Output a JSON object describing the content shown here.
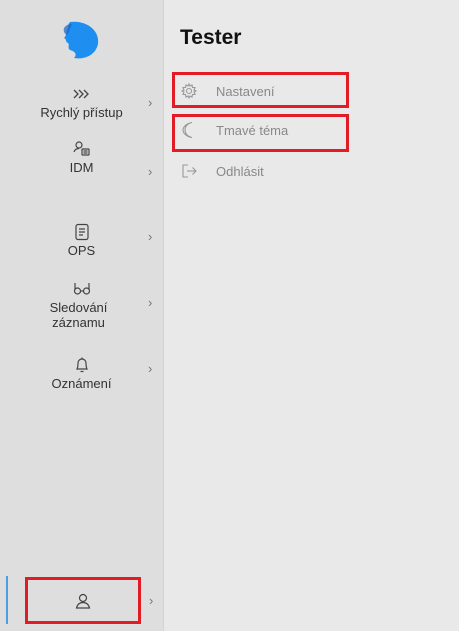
{
  "sidebar": {
    "items": [
      {
        "icon": "fast-forward-icon",
        "label": "Rychlý přístup"
      },
      {
        "icon": "user-card-icon",
        "label": "IDM"
      },
      {
        "icon": "document-icon",
        "label": "OPS"
      },
      {
        "icon": "glasses-icon",
        "label": "Sledování záznamu"
      },
      {
        "icon": "bell-icon",
        "label": "Oznámení"
      }
    ],
    "chevron": "›",
    "user_icon": "user-icon"
  },
  "panel": {
    "title": "Tester",
    "menu": [
      {
        "icon": "gear-icon",
        "label": "Nastavení"
      },
      {
        "icon": "moon-icon",
        "label": "Tmavé téma"
      },
      {
        "icon": "logout-icon",
        "label": "Odhlásit"
      }
    ]
  },
  "colors": {
    "highlight": "#e21c24",
    "logo_blue": "#1e8ff0",
    "active_bar": "#4a9fe0"
  }
}
